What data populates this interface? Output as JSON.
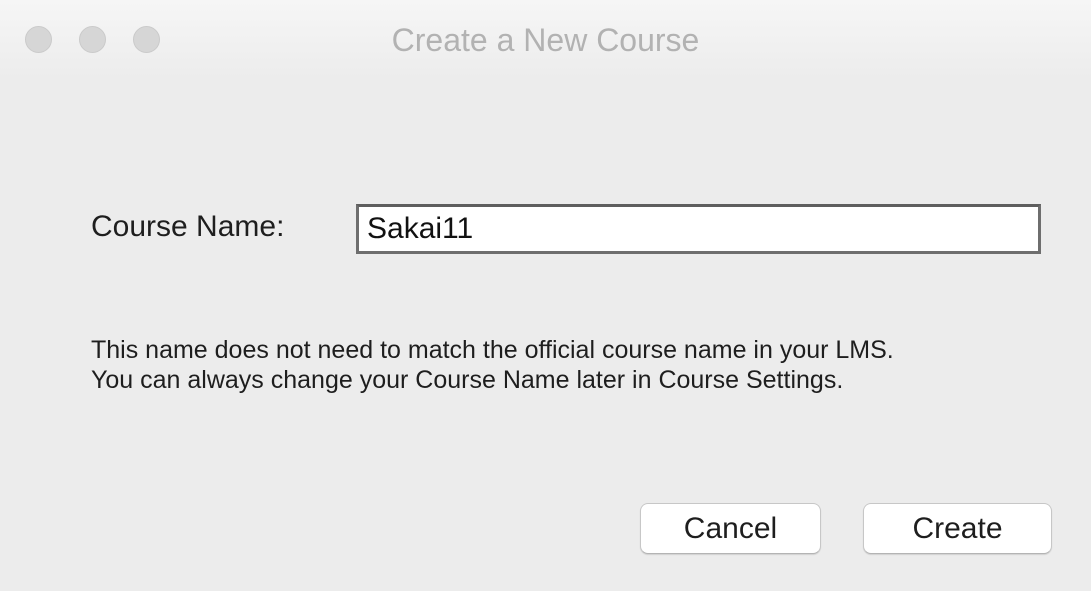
{
  "window": {
    "title": "Create a New Course",
    "traffic_lights": [
      "close",
      "minimize",
      "zoom"
    ]
  },
  "form": {
    "course_name_label": "Course Name:",
    "course_name_value": "Sakai11",
    "help_line_1": "This name does not need to match the official course name in your LMS.",
    "help_line_2": "You can always change your Course Name later in Course Settings."
  },
  "buttons": {
    "cancel_label": "Cancel",
    "create_label": "Create"
  }
}
